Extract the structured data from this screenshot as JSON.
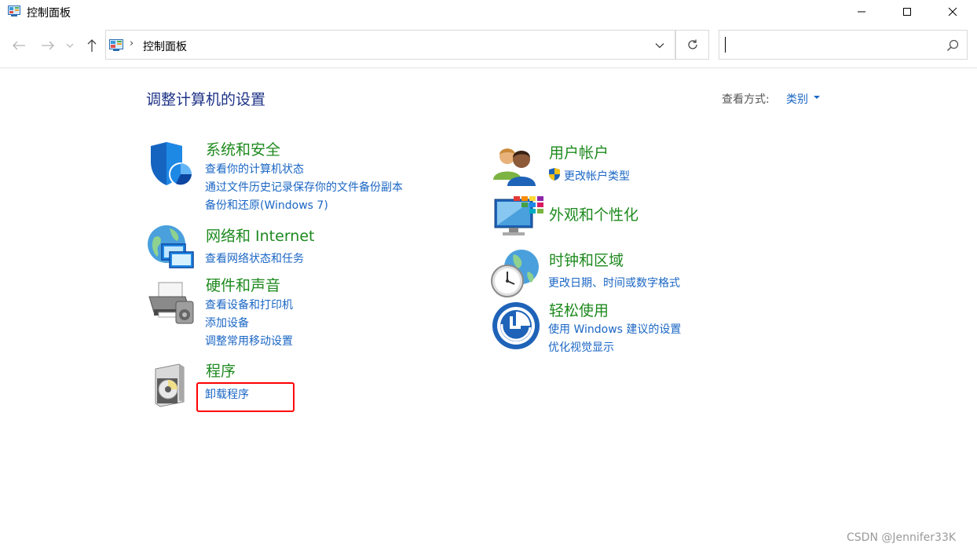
{
  "window": {
    "title": "控制面板"
  },
  "address_bar": {
    "path_item": "控制面板",
    "separator": "›"
  },
  "search": {
    "placeholder": ""
  },
  "main": {
    "page_title": "调整计算机的设置",
    "view_by_label": "查看方式:",
    "view_by_value": "类别"
  },
  "categories": {
    "system_security": {
      "title": "系统和安全",
      "links": [
        "查看你的计算机状态",
        "通过文件历史记录保存你的文件备份副本",
        "备份和还原(Windows 7)"
      ]
    },
    "network_internet": {
      "title": "网络和 Internet",
      "links": [
        "查看网络状态和任务"
      ]
    },
    "hardware_sound": {
      "title": "硬件和声音",
      "links": [
        "查看设备和打印机",
        "添加设备",
        "调整常用移动设置"
      ]
    },
    "programs": {
      "title": "程序",
      "links": [
        "卸载程序"
      ]
    },
    "user_accounts": {
      "title": "用户帐户",
      "links": [
        "更改帐户类型"
      ]
    },
    "appearance": {
      "title": "外观和个性化",
      "links": []
    },
    "clock_region": {
      "title": "时钟和区域",
      "links": [
        "更改日期、时间或数字格式"
      ]
    },
    "ease_of_access": {
      "title": "轻松使用",
      "links": [
        "使用 Windows 建议的设置",
        "优化视觉显示"
      ]
    }
  },
  "colors": {
    "category_title": "#1e8a1e",
    "link": "#1a66c4",
    "page_title": "#1e3287",
    "highlight": "#ff0000"
  },
  "watermark": "CSDN @Jennifer33K"
}
